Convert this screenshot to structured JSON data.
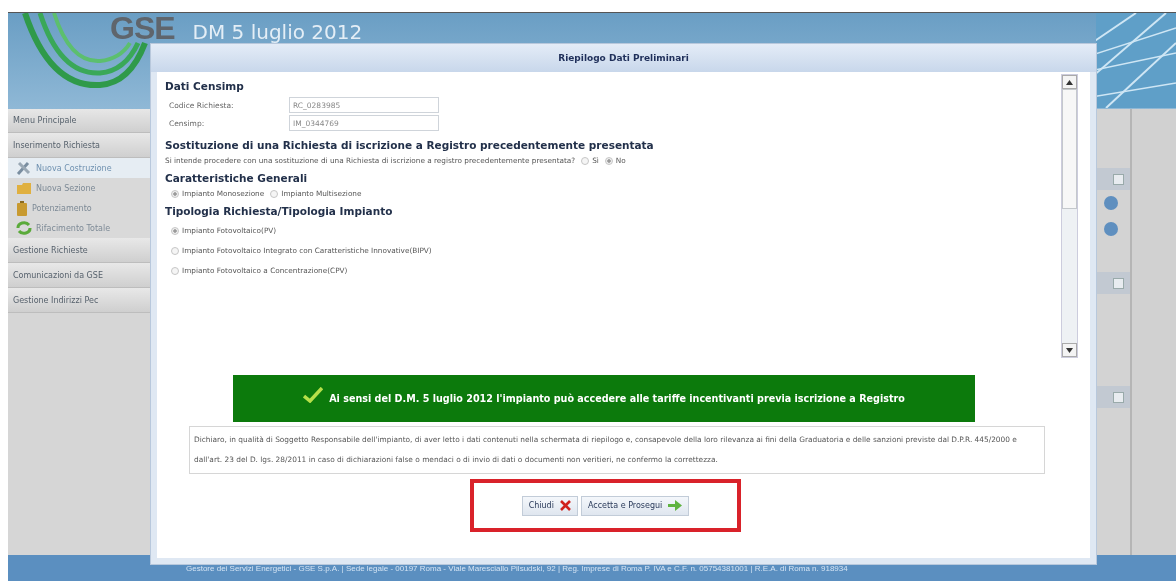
{
  "app_header": {
    "logo_text": "GSE",
    "title": "DM 5 luglio 2012"
  },
  "sidebar": {
    "items": [
      {
        "label": "Menu Principale",
        "kind": "section",
        "selected": false
      },
      {
        "label": "Inserimento Richiesta",
        "kind": "section",
        "selected": false
      },
      {
        "label": "Nuova Costruzione",
        "kind": "tools",
        "selected": true
      },
      {
        "label": "Nuova Sezione",
        "kind": "folder",
        "selected": false
      },
      {
        "label": "Potenziamento",
        "kind": "battery",
        "selected": false
      },
      {
        "label": "Rifacimento Totale",
        "kind": "recycle",
        "selected": false
      },
      {
        "label": "Gestione Richieste",
        "kind": "section",
        "selected": false
      },
      {
        "label": "Comunicazioni da GSE",
        "kind": "section",
        "selected": false
      },
      {
        "label": "Gestione Indirizzi Pec",
        "kind": "section",
        "selected": false
      }
    ]
  },
  "dialog": {
    "title": "Riepilogo Dati Preliminari",
    "blocks": [
      {
        "kind": "heading",
        "text": "Dati Censimp"
      },
      {
        "kind": "fields",
        "fields": [
          {
            "label": "Codice Richiesta:",
            "value": "RC_0283985"
          },
          {
            "label": "Censimp:",
            "value": "IM_0344769"
          }
        ]
      },
      {
        "kind": "heading",
        "text": "Sostituzione di una Richiesta di iscrizione a Registro precedentemente presentata"
      },
      {
        "kind": "question",
        "text": "Si intende procedere con una sostituzione di una Richiesta di iscrizione a registro precedentemente presentata?",
        "options": [
          {
            "label": "Sì",
            "selected": false
          },
          {
            "label": "No",
            "selected": true
          }
        ]
      },
      {
        "kind": "heading",
        "text": "Caratteristiche Generali"
      },
      {
        "kind": "inline_radios",
        "options": [
          {
            "label": "Impianto Monosezione",
            "selected": true
          },
          {
            "label": "Impianto Multisezione",
            "selected": false
          }
        ]
      },
      {
        "kind": "heading",
        "text": "Tipologia Richiesta/Tipologia Impianto"
      },
      {
        "kind": "stacked_radios",
        "options": [
          {
            "label": "Impianto Fotovoltaico(PV)",
            "selected": true
          },
          {
            "label": "Impianto Fotovoltaico Integrato con Caratteristiche Innovative(BIPV)",
            "selected": false
          },
          {
            "label": "Impianto Fotovoltaico a Concentrazione(CPV)",
            "selected": false
          }
        ]
      }
    ],
    "banner": "Ai sensi del D.M. 5 luglio 2012 l'impianto può accedere alle tariffe incentivanti previa iscrizione a Registro",
    "declaration": "Dichiaro, in qualità di Soggetto Responsabile dell'impianto, di aver letto i dati contenuti nella schermata di riepilogo e, consapevole della loro rilevanza ai fini della Graduatoria e delle sanzioni previste dal D.P.R. 445/2000 e dall'art. 23 del D. lgs. 28/2011 in caso di dichiarazioni false o mendaci o di invio di dati o documenti non veritieri, ne confermo la correttezza.",
    "buttons": [
      {
        "label": "Chiudi",
        "kind": "close"
      },
      {
        "label": "Accetta e Prosegui",
        "kind": "proceed"
      }
    ]
  },
  "footer": "Gestore dei Servizi Energetici - GSE S.p.A. | Sede legale - 00197 Roma - Viale Maresciallo Pilsudski, 92 | Reg. Imprese di Roma P. IVA e C.F. n. 05754381001 | R.E.A. di Roma n. 918934"
}
